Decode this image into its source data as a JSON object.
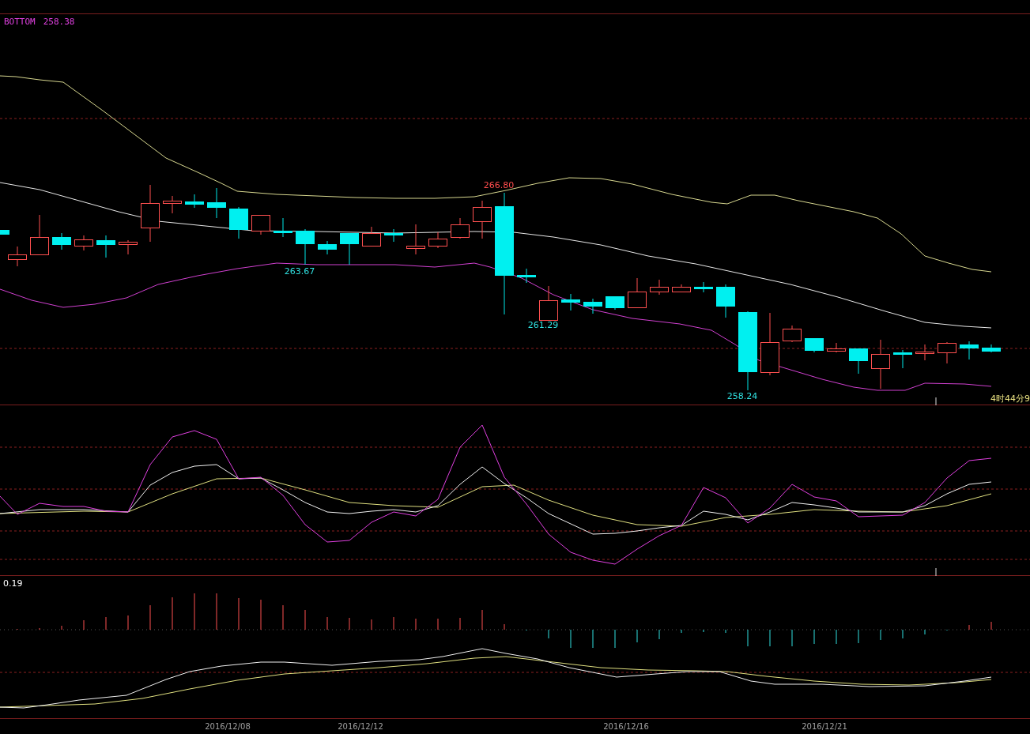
{
  "header": {
    "indicator": "BOTTOM",
    "value": "258.38"
  },
  "price_chart": {
    "annotations": [
      {
        "text": "266.80",
        "kind": "high"
      },
      {
        "text": "263.67",
        "kind": "low"
      },
      {
        "text": "261.29",
        "kind": "low"
      },
      {
        "text": "258.24",
        "kind": "low"
      }
    ],
    "time_label": "4时44分9"
  },
  "macd": {
    "value": "0.19"
  },
  "x_axis": {
    "labels": [
      "2016/12/08",
      "2016/12/12",
      "2016/12/16",
      "2016/12/21"
    ]
  }
}
